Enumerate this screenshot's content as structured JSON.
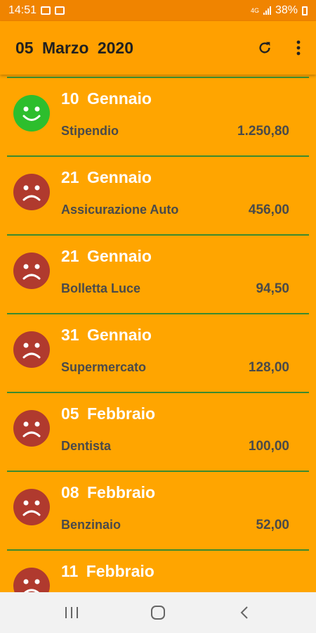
{
  "status_bar": {
    "time": "14:51",
    "network": "4G",
    "battery": "38%",
    "icons": [
      "image-icon",
      "download-icon",
      "signal-icon",
      "battery-icon"
    ]
  },
  "app_bar": {
    "title": "05  Marzo  2020",
    "actions": [
      "refresh-icon",
      "more-vert-icon"
    ]
  },
  "colors": {
    "background": "#FFA500",
    "status_bar": "#F08400",
    "divider": "#3C8A2E",
    "happy": "#2DBE2D",
    "sad": "#B03A2E"
  },
  "transactions": [
    {
      "date": "10  Gennaio",
      "description": "Stipendio",
      "amount": "1.250,80",
      "mood": "happy"
    },
    {
      "date": "21  Gennaio",
      "description": "Assicurazione Auto",
      "amount": "456,00",
      "mood": "sad"
    },
    {
      "date": "21  Gennaio",
      "description": "Bolletta Luce",
      "amount": "94,50",
      "mood": "sad"
    },
    {
      "date": "31  Gennaio",
      "description": "Supermercato",
      "amount": "128,00",
      "mood": "sad"
    },
    {
      "date": "05  Febbraio",
      "description": "Dentista",
      "amount": "100,00",
      "mood": "sad"
    },
    {
      "date": "08  Febbraio",
      "description": "Benzinaio",
      "amount": "52,00",
      "mood": "sad"
    },
    {
      "date": "11  Febbraio",
      "description": "",
      "amount": "",
      "mood": "sad"
    }
  ],
  "nav_bar": {
    "buttons": [
      "recent-apps-icon",
      "home-icon",
      "back-icon"
    ]
  }
}
